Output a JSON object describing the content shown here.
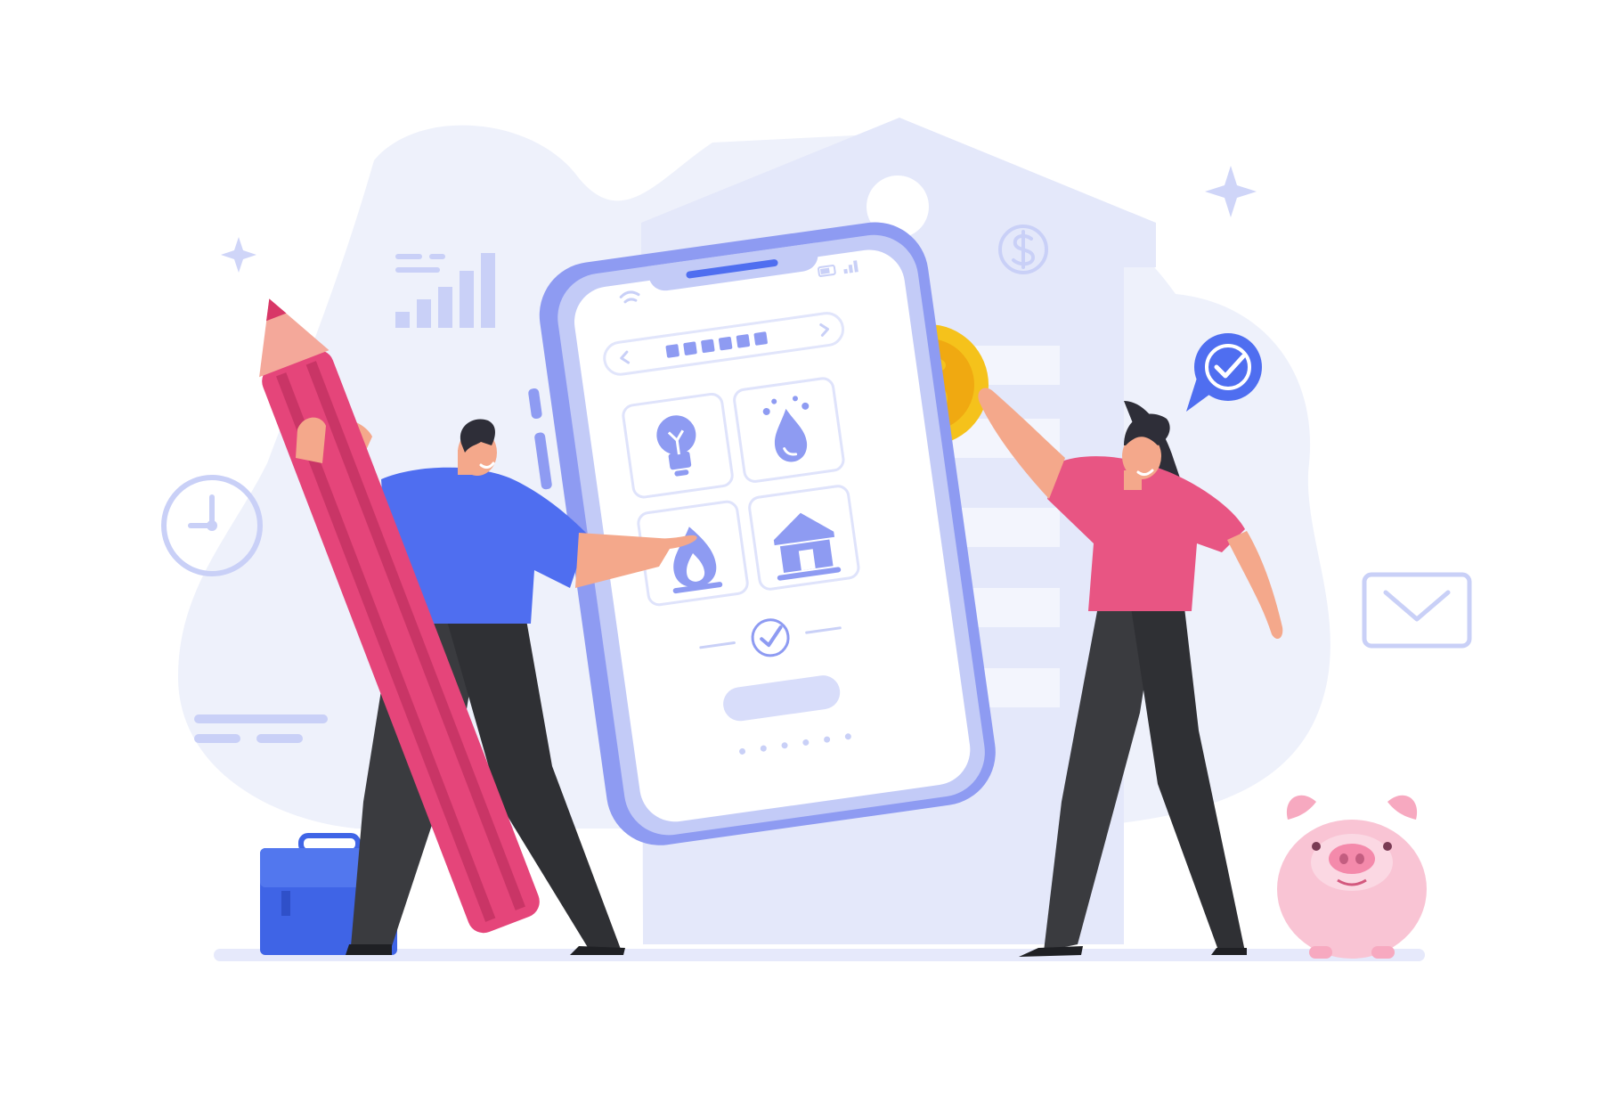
{
  "colors": {
    "background": "#ffffff",
    "blob": "#eef1fb",
    "house": "#e4e8fa",
    "lavender": "#c9d0f7",
    "periwinkle": "#8e9bf2",
    "accent_blue": "#4f6ef0",
    "pencil_pink": "#e5457a",
    "shirt_pink": "#e85583",
    "skin": "#f4a88b",
    "hair": "#2e2e38",
    "pants": "#3a3b3f",
    "coin": "#f5c21b",
    "piggy": "#f9c4d4",
    "case_blue": "#3f64e6"
  },
  "icons": [
    "sparkle-icon",
    "bar-chart-icon",
    "clock-icon",
    "dollar-badge-icon",
    "checkmark-bubble-icon",
    "envelope-icon",
    "lightbulb-icon",
    "water-drop-icon",
    "flame-icon",
    "house-icon",
    "check-circle-icon",
    "wifi-icon",
    "battery-icon",
    "signal-icon",
    "chevron-left-icon",
    "chevron-right-icon",
    "coin-icon",
    "pencil-icon",
    "briefcase-icon",
    "piggy-bank-icon"
  ],
  "phone": {
    "utility_tiles": [
      "electricity",
      "water",
      "gas",
      "housing"
    ],
    "carousel_dot_count": 6
  }
}
